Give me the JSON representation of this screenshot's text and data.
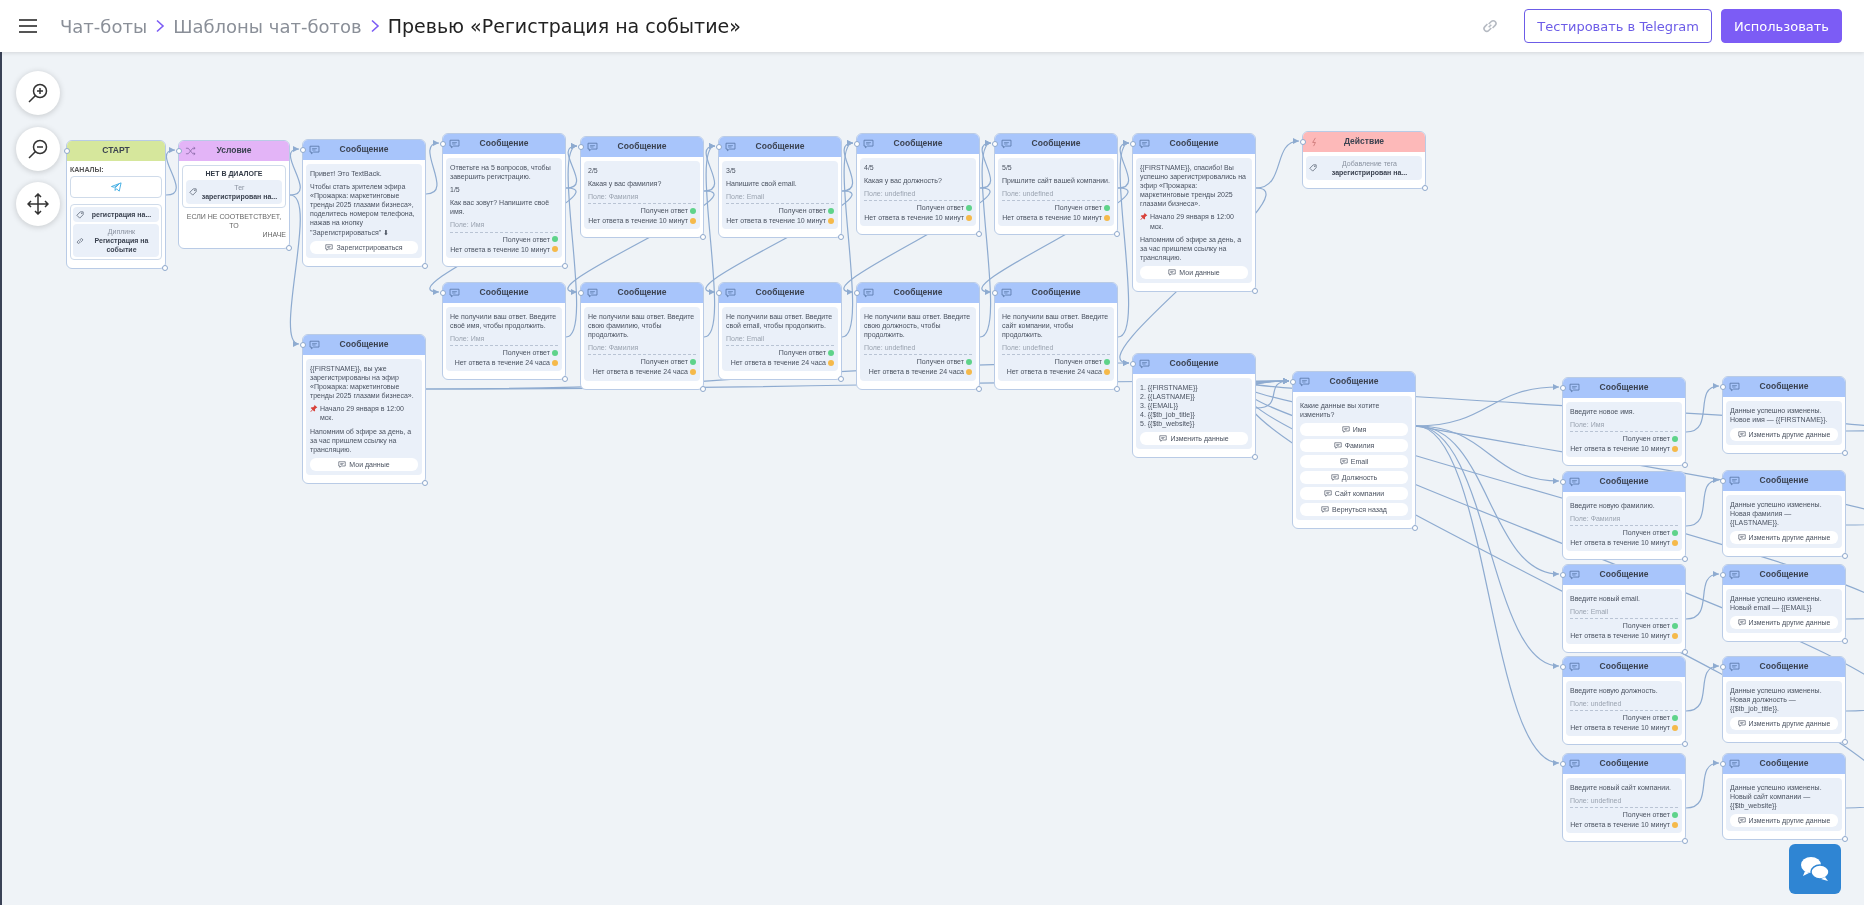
{
  "header": {
    "breadcrumbs": [
      {
        "label": "Чат-боты"
      },
      {
        "label": "Шаблоны чат-ботов"
      }
    ],
    "title": "Превью «Регистрация на событие»",
    "buttons": [
      {
        "label": "Тестировать в Telegram",
        "kind": "outline"
      },
      {
        "label": "Использовать",
        "kind": "primary"
      }
    ]
  },
  "nodes": [
    {
      "kind": "start",
      "title": "СТАРТ",
      "channels_label": "КАНАЛЫ:",
      "triggers": [
        {
          "kind": "tag",
          "value": "регистрация на..."
        },
        {
          "kind": "link",
          "label": "Диплинк",
          "value": "Регистрация на событие"
        }
      ]
    },
    {
      "kind": "condition",
      "title": "Условие",
      "rule": "НЕТ В ДИАЛОГЕ",
      "tag_label": "Тег",
      "tag_value": "зарегистрирован на...",
      "else_text": "ЕСЛИ НЕ СООТВЕТСТВУЕТ, ТО",
      "else_tail": "ИНАЧЕ"
    },
    {
      "kind": "message",
      "title": "Сообщение",
      "paragraphs": [
        {
          "text": "Привет! Это TextBack."
        },
        {
          "text": "Чтобы стать зрителем эфира «Прожарка: маркетинговые тренды 2025 глазами бизнеса», поделитесь номером телефона, нажав на кнопку \"Зарегистрироваться\" ⬇"
        }
      ],
      "buttons": [
        "Зарегистрироваться"
      ]
    },
    {
      "kind": "message",
      "title": "Сообщение",
      "paragraphs": [
        {
          "text": "Ответьте на 5 вопросов, чтобы завершить регистрацию."
        },
        {
          "text": "1/5"
        },
        {
          "text": "Как вас зовут? Напишите своё имя."
        }
      ],
      "field": "Поле: Имя",
      "outcomes": [
        {
          "label": "Получен ответ",
          "color": "#5fd38a"
        },
        {
          "label": "Нет ответа в течение 10 минут",
          "color": "#f5b94a"
        }
      ]
    },
    {
      "kind": "message",
      "title": "Сообщение",
      "paragraphs": [
        {
          "text": "2/5"
        },
        {
          "text": "Какая у вас фамилия?"
        }
      ],
      "field": "Поле: Фамилия",
      "outcomes": [
        {
          "label": "Получен ответ",
          "color": "#5fd38a"
        },
        {
          "label": "Нет ответа в течение 10 минут",
          "color": "#f5b94a"
        }
      ]
    },
    {
      "kind": "message",
      "title": "Сообщение",
      "paragraphs": [
        {
          "text": "3/5"
        },
        {
          "text": "Напишите свой email."
        }
      ],
      "field": "Поле: Email",
      "outcomes": [
        {
          "label": "Получен ответ",
          "color": "#5fd38a"
        },
        {
          "label": "Нет ответа в течение 10 минут",
          "color": "#f5b94a"
        }
      ]
    },
    {
      "kind": "message",
      "title": "Сообщение",
      "paragraphs": [
        {
          "text": "4/5"
        },
        {
          "text": "Какая у вас должность?"
        }
      ],
      "field": "Поле: undefined",
      "outcomes": [
        {
          "label": "Получен ответ",
          "color": "#5fd38a"
        },
        {
          "label": "Нет ответа в течение 10 минут",
          "color": "#f5b94a"
        }
      ]
    },
    {
      "kind": "message",
      "title": "Сообщение",
      "paragraphs": [
        {
          "text": "5/5"
        },
        {
          "text": "Пришлите сайт вашей компании."
        }
      ],
      "field": "Поле: undefined",
      "outcomes": [
        {
          "label": "Получен ответ",
          "color": "#5fd38a"
        },
        {
          "label": "Нет ответа в течение 10 минут",
          "color": "#f5b94a"
        }
      ]
    },
    {
      "kind": "message",
      "title": "Сообщение",
      "paragraphs": [
        {
          "text": "{{FIRSTNAME}}, спасибо! Вы успешно зарегистрировались на эфир «Прожарка: маркетинговые тренды 2025 глазами бизнеса»."
        },
        {
          "kind": "pin",
          "text": "Начало 29 января в 12:00 мск."
        },
        {
          "text": "Напомним об эфире за день, а за час пришлем ссылку на трансляцию."
        }
      ],
      "buttons": [
        "Мои данные"
      ]
    },
    {
      "kind": "action",
      "title": "Действие",
      "tag_label": "Добавление тега",
      "tag_value": "зарегистрирован на..."
    },
    {
      "kind": "message",
      "title": "Сообщение",
      "paragraphs": [
        {
          "text": "Не получили ваш ответ. Введите своё имя, чтобы продолжить."
        }
      ],
      "field": "Поле: Имя",
      "outcomes": [
        {
          "label": "Получен ответ",
          "color": "#5fd38a"
        },
        {
          "label": "Нет ответа в течение 24 часа",
          "color": "#f5b94a"
        }
      ]
    },
    {
      "kind": "message",
      "title": "Сообщение",
      "paragraphs": [
        {
          "text": "Не получили ваш ответ. Введите свою фамилию, чтобы продолжить."
        }
      ],
      "field": "Поле: Фамилия",
      "outcomes": [
        {
          "label": "Получен ответ",
          "color": "#5fd38a"
        },
        {
          "label": "Нет ответа в течение 24 часа",
          "color": "#f5b94a"
        }
      ]
    },
    {
      "kind": "message",
      "title": "Сообщение",
      "paragraphs": [
        {
          "text": "Не получили ваш ответ. Введите свой email, чтобы продолжить."
        }
      ],
      "field": "Поле: Email",
      "outcomes": [
        {
          "label": "Получен ответ",
          "color": "#5fd38a"
        },
        {
          "label": "Нет ответа в течение 24 часа",
          "color": "#f5b94a"
        }
      ]
    },
    {
      "kind": "message",
      "title": "Сообщение",
      "paragraphs": [
        {
          "text": "Не получили ваш ответ. Введите свою должность, чтобы продолжить."
        }
      ],
      "field": "Поле: undefined",
      "outcomes": [
        {
          "label": "Получен ответ",
          "color": "#5fd38a"
        },
        {
          "label": "Нет ответа в течение 24 часа",
          "color": "#f5b94a"
        }
      ]
    },
    {
      "kind": "message",
      "title": "Сообщение",
      "paragraphs": [
        {
          "text": "Не получили ваш ответ. Введите сайт компании, чтобы продолжить."
        }
      ],
      "field": "Поле: undefined",
      "outcomes": [
        {
          "label": "Получен ответ",
          "color": "#5fd38a"
        },
        {
          "label": "Нет ответа в течение 24 часа",
          "color": "#f5b94a"
        }
      ]
    },
    {
      "kind": "message",
      "title": "Сообщение",
      "paragraphs": [
        {
          "text": "{{FIRSTNAME}}, вы уже зарегистрированы на эфир «Прожарка: маркетинговые тренды 2025 глазами бизнеса»."
        },
        {
          "kind": "pin",
          "text": "Начало 29 января в 12:00 мск."
        },
        {
          "text": "Напомним об эфире за день, а за час пришлем ссылку на трансляцию."
        }
      ],
      "buttons": [
        "Мои данные"
      ]
    },
    {
      "kind": "message",
      "title": "Сообщение",
      "paragraphs": [
        {
          "text": "1. {{FIRSTNAME}}\n2. {{LASTNAME}}\n3. {{EMAIL}}\n4. {{$tb_job_title}}\n5. {{$tb_website}}"
        }
      ],
      "buttons": [
        "Изменить данные"
      ]
    },
    {
      "kind": "message",
      "title": "Сообщение",
      "paragraphs": [
        {
          "text": "Какие данные вы хотите изменить?"
        }
      ],
      "buttons": [
        "Имя",
        "Фамилия",
        "Email",
        "Должность",
        "Сайт компании",
        "Вернуться назад"
      ]
    },
    {
      "kind": "message",
      "title": "Сообщение",
      "paragraphs": [
        {
          "text": "Введите новое имя."
        }
      ],
      "field": "Поле: Имя",
      "outcomes": [
        {
          "label": "Получен ответ",
          "color": "#5fd38a"
        },
        {
          "label": "Нет ответа в течение 10 минут",
          "color": "#f5b94a"
        }
      ]
    },
    {
      "kind": "message",
      "title": "Сообщение",
      "paragraphs": [
        {
          "text": "Данные успешно изменены. Новое имя — {{FIRSTNAME}}."
        }
      ],
      "buttons": [
        "Изменить другие данные"
      ]
    },
    {
      "kind": "message",
      "title": "Сообщение",
      "paragraphs": [
        {
          "text": "Введите новую фамилию."
        }
      ],
      "field": "Поле: Фамилия",
      "outcomes": [
        {
          "label": "Получен ответ",
          "color": "#5fd38a"
        },
        {
          "label": "Нет ответа в течение 10 минут",
          "color": "#f5b94a"
        }
      ]
    },
    {
      "kind": "message",
      "title": "Сообщение",
      "paragraphs": [
        {
          "text": "Данные успешно изменены. Новая фамилия — {{LASTNAME}}."
        }
      ],
      "buttons": [
        "Изменить другие данные"
      ]
    },
    {
      "kind": "message",
      "title": "Сообщение",
      "paragraphs": [
        {
          "text": "Введите новый email."
        }
      ],
      "field": "Поле: Email",
      "outcomes": [
        {
          "label": "Получен ответ",
          "color": "#5fd38a"
        },
        {
          "label": "Нет ответа в течение 10 минут",
          "color": "#f5b94a"
        }
      ]
    },
    {
      "kind": "message",
      "title": "Сообщение",
      "paragraphs": [
        {
          "text": "Данные успешно изменены. Новый email — {{EMAIL}}"
        }
      ],
      "buttons": [
        "Изменить другие данные"
      ]
    },
    {
      "kind": "message",
      "title": "Сообщение",
      "paragraphs": [
        {
          "text": "Введите новую должность."
        }
      ],
      "field": "Поле: undefined",
      "outcomes": [
        {
          "label": "Получен ответ",
          "color": "#5fd38a"
        },
        {
          "label": "Нет ответа в течение 10 минут",
          "color": "#f5b94a"
        }
      ]
    },
    {
      "kind": "message",
      "title": "Сообщение",
      "paragraphs": [
        {
          "text": "Данные успешно изменены. Новая должность — {{$tb_job_title}}."
        }
      ],
      "buttons": [
        "Изменить другие данные"
      ]
    },
    {
      "kind": "message",
      "title": "Сообщение",
      "paragraphs": [
        {
          "text": "Введите новый сайт компании."
        }
      ],
      "field": "Поле: undefined",
      "outcomes": [
        {
          "label": "Получен ответ",
          "color": "#5fd38a"
        },
        {
          "label": "Нет ответа в течение 10 минут",
          "color": "#f5b94a"
        }
      ]
    },
    {
      "kind": "message",
      "title": "Сообщение",
      "paragraphs": [
        {
          "text": "Данные успешно изменены. Новый сайт компании — {{$tb_website}}"
        }
      ],
      "buttons": [
        "Изменить другие данные"
      ]
    }
  ]
}
